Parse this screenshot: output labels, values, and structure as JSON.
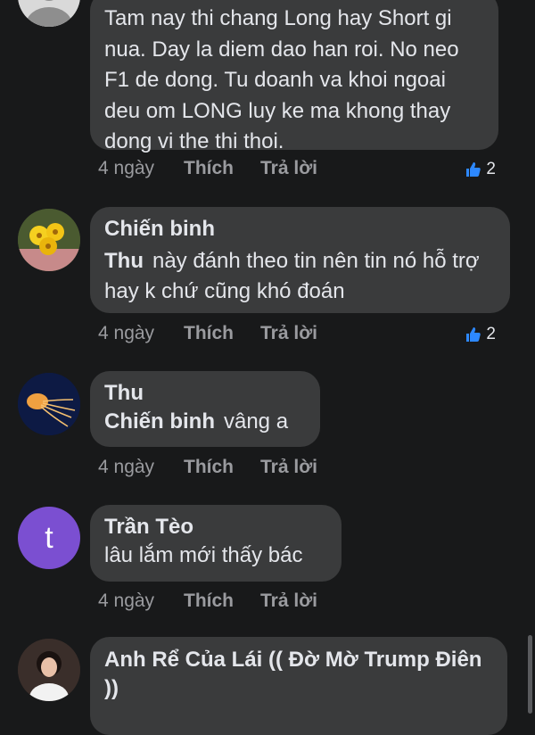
{
  "comments": [
    {
      "author": "",
      "text": "Tam nay thi chang Long hay Short gi nua. Day la diem dao han roi. No neo F1 de dong. Tu doanh va khoi ngoai deu om LONG luy ke ma khong thay dong vi the thi thoi.",
      "time": "4 ngày",
      "like": "Thích",
      "reply": "Trả lời",
      "reaction_count": "2"
    },
    {
      "author": "Chiến binh",
      "mention": "Thu",
      "text": "này đánh theo tin nên tin nó hỗ trợ hay k chứ cũng khó đoán",
      "time": "4 ngày",
      "like": "Thích",
      "reply": "Trả lời",
      "reaction_count": "2"
    },
    {
      "author": "Thu",
      "mention": "Chiến binh",
      "text": "vâng a",
      "time": "4 ngày",
      "like": "Thích",
      "reply": "Trả lời"
    },
    {
      "author": "Trần Tèo",
      "avatar_letter": "t",
      "text": "lâu lắm mới thấy bác",
      "time": "4 ngày",
      "like": "Thích",
      "reply": "Trả lời"
    },
    {
      "author": "Anh Rể Của Lái (( Đờ Mờ Trump Điên ))"
    }
  ],
  "colors": {
    "background": "#18191a",
    "bubble": "#3a3b3c",
    "like_blue": "#2d88ff",
    "avatar_purple": "#7b4fd1"
  }
}
